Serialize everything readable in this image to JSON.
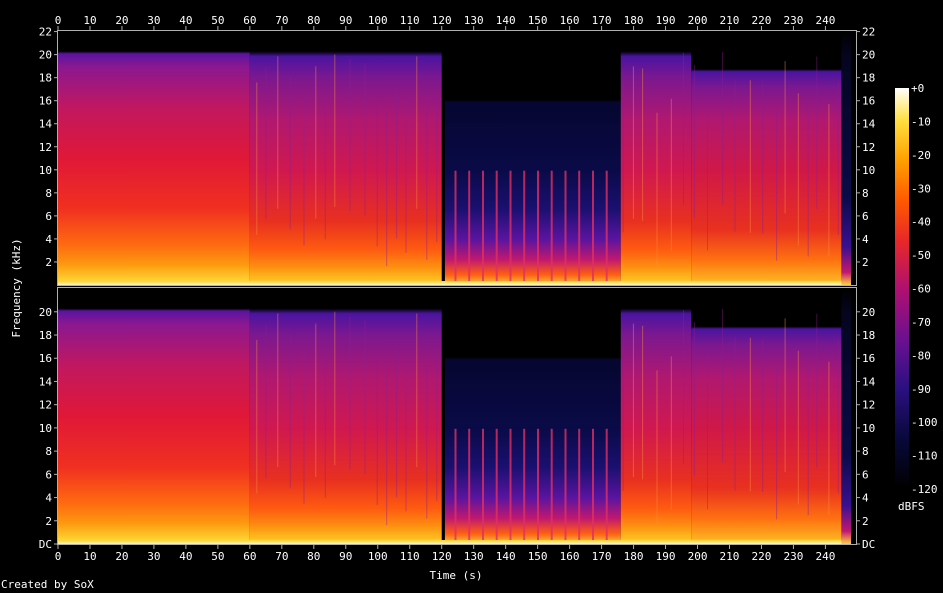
{
  "chart_data": {
    "type": "heatmap",
    "subtype": "spectrogram",
    "channels": 2,
    "xlabel": "Time (s)",
    "ylabel": "Frequency (kHz)",
    "xlim": [
      0,
      248
    ],
    "ylim": [
      0,
      22.05
    ],
    "x_ticks": [
      0,
      10,
      20,
      30,
      40,
      50,
      60,
      70,
      80,
      90,
      100,
      110,
      120,
      130,
      140,
      150,
      160,
      170,
      180,
      190,
      200,
      210,
      220,
      230,
      240
    ],
    "y_ticks": [
      2,
      4,
      6,
      8,
      10,
      12,
      14,
      16,
      18,
      20,
      22
    ],
    "y_tick_labels_top": [
      "2",
      "4",
      "6",
      "8",
      "10",
      "12",
      "14",
      "16",
      "18",
      "20",
      "22"
    ],
    "y_tick_labels_bottom": [
      "DC",
      "2",
      "4",
      "6",
      "8",
      "10",
      "12",
      "14",
      "16",
      "18",
      "20"
    ],
    "colorbar": {
      "label": "dBFS",
      "ticks": [
        0,
        -10,
        -20,
        -30,
        -40,
        -50,
        -60,
        -70,
        -80,
        -90,
        -100,
        -110,
        -120
      ],
      "tick_labels": [
        "+0",
        "-10",
        "-20",
        "-30",
        "-40",
        "-50",
        "-60",
        "-70",
        "-80",
        "-90",
        "-100",
        "-110",
        "-120"
      ],
      "range": [
        -120,
        0
      ]
    },
    "segments": [
      {
        "start": 0,
        "end": 60,
        "description_level_db": -55,
        "cutoff_khz": 20
      },
      {
        "start": 60,
        "end": 120,
        "description_level_db": -60,
        "cutoff_khz": 20
      },
      {
        "start": 121,
        "end": 176,
        "description_level_db": -110,
        "cutoff_khz": 16
      },
      {
        "start": 176,
        "end": 198,
        "description_level_db": -60,
        "cutoff_khz": 20
      },
      {
        "start": 198,
        "end": 245,
        "description_level_db": -62,
        "cutoff_khz": 18
      }
    ],
    "grid": false
  },
  "footer": {
    "credit": "Created by SoX"
  },
  "colors": {
    "background": "#000000",
    "axis": "#b0b0b0",
    "text": "#ffffff"
  }
}
